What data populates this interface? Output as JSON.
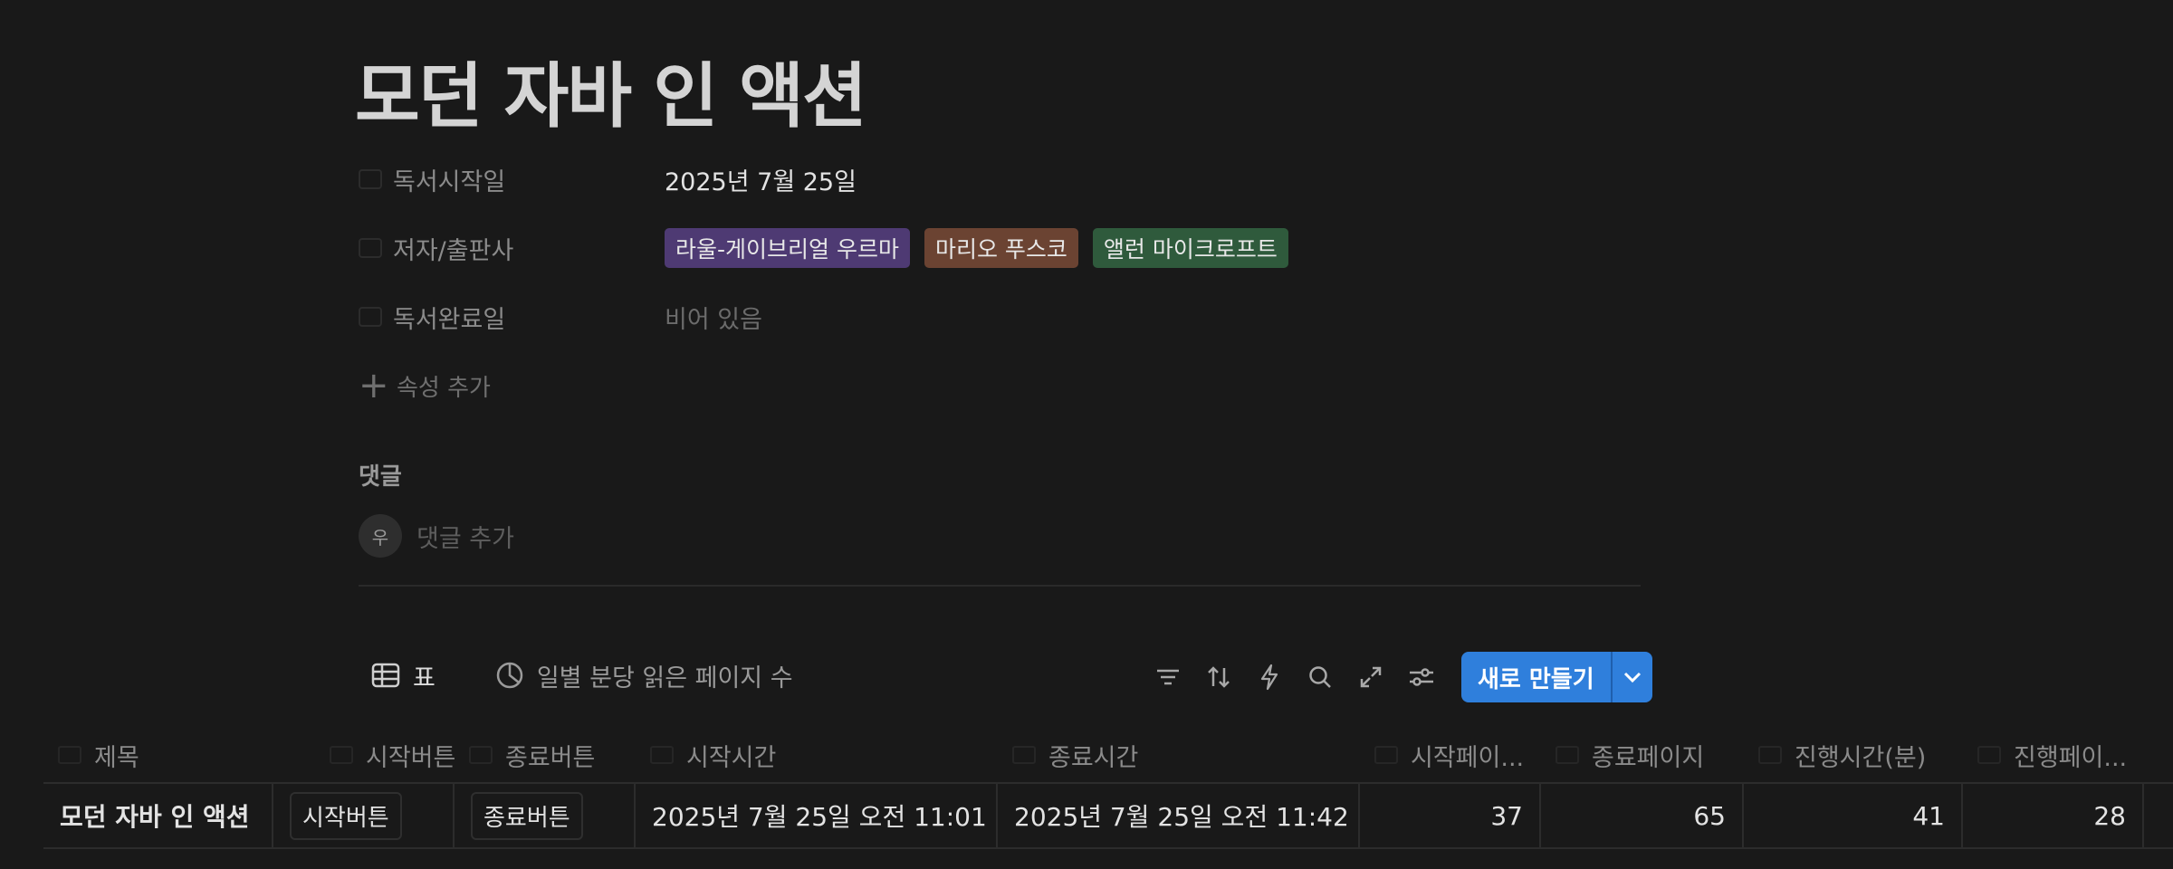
{
  "page": {
    "title": "모던 자바 인 액션"
  },
  "properties": [
    {
      "label": "독서시작일",
      "value": "2025년 7월 25일",
      "icon": "calendar-icon"
    },
    {
      "label": "저자/출판사",
      "icon": "multi-select-icon",
      "tags": [
        {
          "text": "라울-게이브리얼 우르마",
          "color": "#4e3a73"
        },
        {
          "text": "마리오 푸스코",
          "color": "#6b4332"
        },
        {
          "text": "앨런 마이크로프트",
          "color": "#2f5a3c"
        }
      ]
    },
    {
      "label": "독서완료일",
      "value": "비어 있음",
      "icon": "calendar-icon"
    }
  ],
  "add_property_label": "속성 추가",
  "comments": {
    "heading": "댓글",
    "avatar_initial": "우",
    "placeholder": "댓글 추가"
  },
  "views": {
    "tabs": [
      {
        "label": "표",
        "icon": "table-icon",
        "active": true
      },
      {
        "label": "일별 분당 읽은 페이지 수",
        "icon": "chart-icon",
        "active": false
      }
    ]
  },
  "toolbar": {
    "icons": [
      "filter-icon",
      "sort-icon",
      "automation-icon",
      "search-icon",
      "expand-icon",
      "settings-icon"
    ],
    "new_button_label": "새로 만들기"
  },
  "table": {
    "columns": [
      {
        "label": "제목",
        "icon": "text-icon"
      },
      {
        "label": "시작버튼",
        "icon": "button-icon"
      },
      {
        "label": "종료버튼",
        "icon": "button-icon"
      },
      {
        "label": "시작시간",
        "icon": "calendar-icon"
      },
      {
        "label": "종료시간",
        "icon": "calendar-icon"
      },
      {
        "label": "시작페이...",
        "icon": "number-icon"
      },
      {
        "label": "종료페이지",
        "icon": "number-icon"
      },
      {
        "label": "진행시간(분)",
        "icon": "formula-icon"
      },
      {
        "label": "진행페이...",
        "icon": "formula-icon"
      }
    ],
    "rows": [
      {
        "title": "모던 자바 인 액션",
        "start_button": "시작버튼",
        "end_button": "종료버튼",
        "start_time": "2025년 7월 25일 오전 11:01",
        "end_time": "2025년 7월 25일 오전 11:42",
        "start_page": "37",
        "end_page": "65",
        "duration_min": "41",
        "pages_read": "28"
      }
    ]
  }
}
